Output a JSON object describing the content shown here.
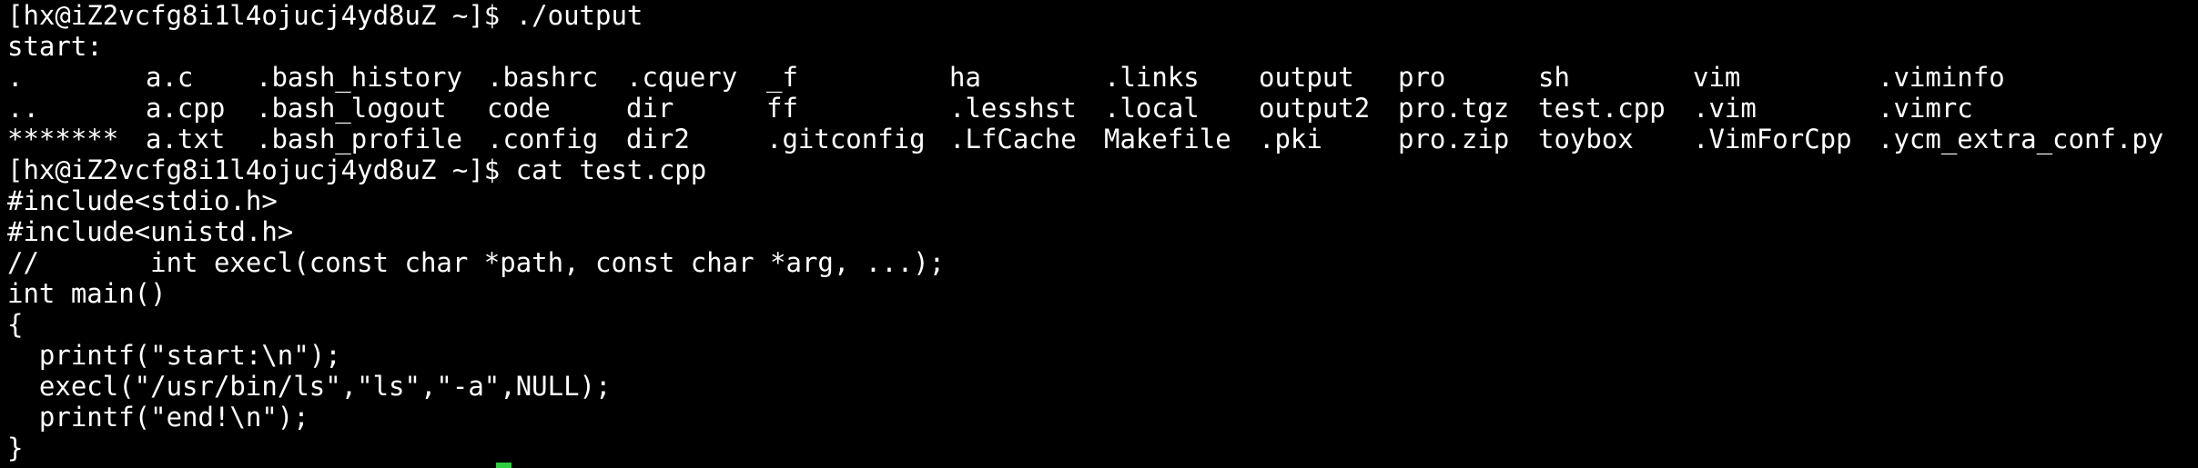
{
  "terminal": {
    "prompt1": "[hx@iZ2vcfg8i1l4ojucj4yd8uZ ~]$ ./output",
    "start": "start:",
    "ls_rows": [
      [
        ".",
        "a.c",
        ".bash_history",
        ".bashrc",
        ".cquery",
        "_f",
        "ha",
        ".links",
        "output",
        "pro",
        "sh",
        "vim",
        ".viminfo"
      ],
      [
        "..",
        "a.cpp",
        ".bash_logout",
        "code",
        "dir",
        "ff",
        ".lesshst",
        ".local",
        "output2",
        "pro.tgz",
        "test.cpp",
        ".vim",
        ".vimrc"
      ],
      [
        "*******",
        "a.txt",
        ".bash_profile",
        ".config",
        "dir2",
        ".gitconfig",
        ".LfCache",
        "Makefile",
        ".pki",
        "pro.zip",
        "toybox",
        ".VimForCpp",
        ".ycm_extra_conf.py"
      ]
    ],
    "prompt2": "[hx@iZ2vcfg8i1l4ojucj4yd8uZ ~]$ cat test.cpp",
    "code": [
      "#include<stdio.h>",
      "#include<unistd.h>",
      "//       int execl(const char *path, const char *arg, ...);",
      "int main()",
      "{",
      "  printf(\"start:\\n\");",
      "  execl(\"/usr/bin/ls\",\"ls\",\"-a\",NULL);",
      "  printf(\"end!\\n\");",
      "}"
    ],
    "cursor_color": "#2ecc40"
  }
}
